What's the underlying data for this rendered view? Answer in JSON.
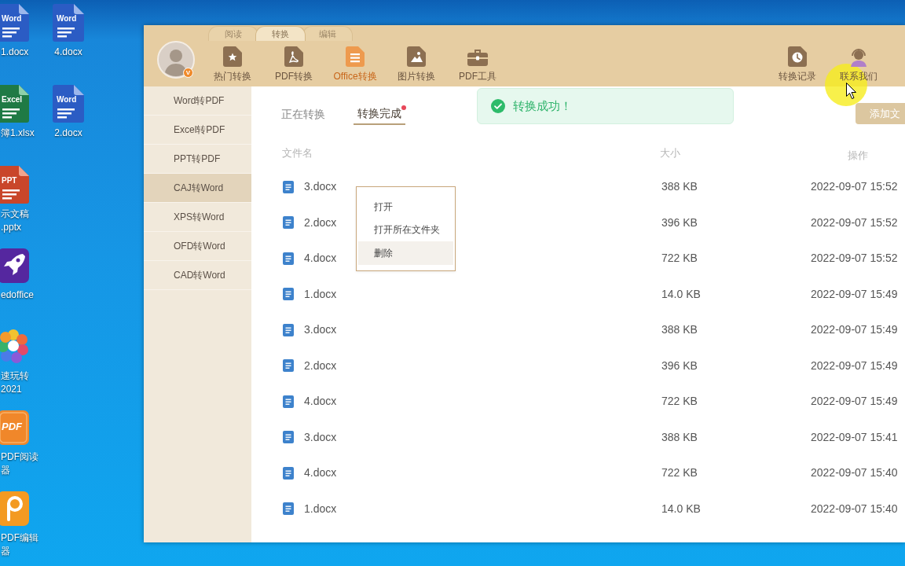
{
  "desktop": {
    "columns": [
      [
        {
          "kind": "word",
          "badge": "Word",
          "label": [
            "1.docx"
          ]
        },
        {
          "kind": "excel",
          "badge": "Excel",
          "label": [
            "簿1.xlsx"
          ]
        },
        {
          "kind": "ppt",
          "badge": "PPT",
          "label": [
            "示文稿",
            ".pptx"
          ]
        },
        {
          "kind": "rocket",
          "label": [
            "edoffice"
          ]
        },
        {
          "kind": "pinwheel",
          "label": [
            "速玩转",
            "2021"
          ]
        },
        {
          "kind": "pdf-reader",
          "badge": "PDF",
          "label": [
            "PDF阅读",
            "器"
          ]
        },
        {
          "kind": "pdf-editor",
          "label": [
            "PDF编辑",
            "器"
          ]
        }
      ],
      [
        {
          "kind": "word",
          "badge": "Word",
          "label": [
            "4.docx"
          ]
        },
        {
          "kind": "word",
          "badge": "Word",
          "label": [
            "2.docx"
          ]
        }
      ]
    ]
  },
  "app": {
    "mode_tabs": [
      {
        "label": "阅读",
        "selected": false
      },
      {
        "label": "转换",
        "selected": true
      },
      {
        "label": "编辑",
        "selected": false
      }
    ],
    "avatar": {
      "badge": "V"
    },
    "toolbar": [
      {
        "kind": "hot",
        "label": "热门转换",
        "selected": false
      },
      {
        "kind": "pdf",
        "label": "PDF转换",
        "selected": false
      },
      {
        "kind": "office",
        "label": "Office转换",
        "selected": true
      },
      {
        "kind": "image",
        "label": "图片转换",
        "selected": false
      },
      {
        "kind": "tools",
        "label": "PDF工具",
        "selected": false
      }
    ],
    "toolbar_right": [
      {
        "kind": "history",
        "label": "转换记录"
      },
      {
        "kind": "contact",
        "label": "联系我们"
      }
    ],
    "sidebar": [
      {
        "label": "Word转PDF",
        "selected": false
      },
      {
        "label": "Excel转PDF",
        "selected": false
      },
      {
        "label": "PPT转PDF",
        "selected": false
      },
      {
        "label": "CAJ转Word",
        "selected": true
      },
      {
        "label": "XPS转Word",
        "selected": false
      },
      {
        "label": "OFD转Word",
        "selected": false
      },
      {
        "label": "CAD转Word",
        "selected": false
      }
    ],
    "result_tabs": [
      {
        "label": "正在转换",
        "selected": false,
        "unread": false
      },
      {
        "label": "转换完成",
        "selected": true,
        "unread": true
      }
    ],
    "toast": {
      "text": "转换成功！"
    },
    "add_button": "添加文",
    "table": {
      "columns": [
        "文件名",
        "大小",
        "操作"
      ],
      "rows": [
        {
          "name": "3.docx",
          "size": "388 KB",
          "time": "2022-09-07 15:52"
        },
        {
          "name": "2.docx",
          "size": "396 KB",
          "time": "2022-09-07 15:52"
        },
        {
          "name": "4.docx",
          "size": "722 KB",
          "time": "2022-09-07 15:52"
        },
        {
          "name": "1.docx",
          "size": "14.0 KB",
          "time": "2022-09-07 15:49"
        },
        {
          "name": "3.docx",
          "size": "388 KB",
          "time": "2022-09-07 15:49"
        },
        {
          "name": "2.docx",
          "size": "396 KB",
          "time": "2022-09-07 15:49"
        },
        {
          "name": "4.docx",
          "size": "722 KB",
          "time": "2022-09-07 15:49"
        },
        {
          "name": "3.docx",
          "size": "388 KB",
          "time": "2022-09-07 15:41"
        },
        {
          "name": "4.docx",
          "size": "722 KB",
          "time": "2022-09-07 15:40"
        },
        {
          "name": "1.docx",
          "size": "14.0 KB",
          "time": "2022-09-07 15:40"
        }
      ]
    },
    "context_menu": [
      {
        "label": "打开",
        "highlighted": false
      },
      {
        "label": "打开所在文件夹",
        "highlighted": false
      },
      {
        "label": "删除",
        "highlighted": true
      }
    ]
  }
}
